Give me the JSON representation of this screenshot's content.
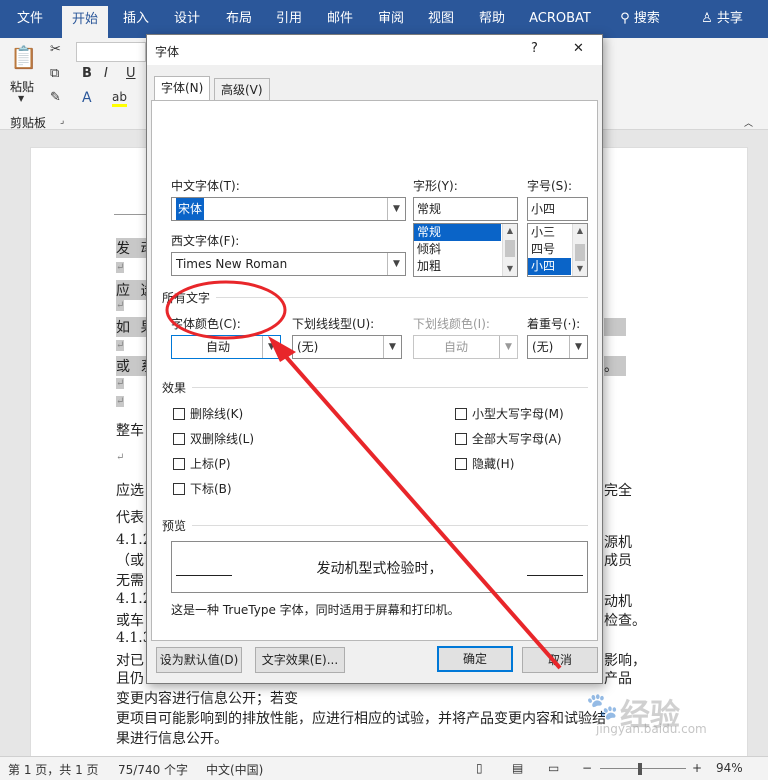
{
  "ribbon": {
    "tabs": [
      "文件",
      "开始",
      "插入",
      "设计",
      "布局",
      "引用",
      "邮件",
      "审阅",
      "视图",
      "帮助",
      "ACROBAT"
    ],
    "search": "搜索",
    "share": "共享",
    "paste_label": "粘贴",
    "clipboard_group": "剪贴板",
    "bold": "B",
    "italic": "I",
    "underline": "U"
  },
  "document": {
    "lines": [
      "发 动",
      "应 选",
      "如 果",
      "或 系",
      "整车",
      "应选",
      "代表",
      "4.1.2",
      "（或",
      "无需",
      "4.1.2",
      "或车",
      "4.1.3",
      "对已",
      "且仍",
      "变更内容进行信息公开；若变",
      "更项目可能影响到的排放性能，应进行相应的试验，并将产品变更内容和试验结",
      "果进行信息公开。"
    ],
    "right_fragments": [
      "完全",
      "源机",
      "成员",
      "动机",
      "检查。",
      "影响，",
      "产品",
      "。"
    ],
    "pilcrow": "↵"
  },
  "status": {
    "page": "第 1 页，共 1 页",
    "words": "75/740 个字",
    "lang": "中文(中国)",
    "zoom": "94%"
  },
  "dialog": {
    "title": "字体",
    "help": "?",
    "close": "✕",
    "tabs": [
      "字体(N)",
      "高级(V)"
    ],
    "cn_font_label": "中文字体(T):",
    "cn_font_value": "宋体",
    "west_font_label": "西文字体(F):",
    "west_font_value": "Times New Roman",
    "style_label": "字形(Y):",
    "style_value": "常规",
    "style_options": [
      "常规",
      "倾斜",
      "加粗"
    ],
    "size_label": "字号(S):",
    "size_value": "小四",
    "size_options": [
      "小三",
      "四号",
      "小四"
    ],
    "all_text_section": "所有文字",
    "color_label": "字体颜色(C):",
    "color_value": "自动",
    "underline_label": "下划线线型(U):",
    "underline_value": "(无)",
    "underline_color_label": "下划线颜色(I):",
    "underline_color_value": "自动",
    "emphasis_label": "着重号(·):",
    "emphasis_value": "(无)",
    "effects_section": "效果",
    "effects_left": [
      "删除线(K)",
      "双删除线(L)",
      "上标(P)",
      "下标(B)"
    ],
    "effects_right": [
      "小型大写字母(M)",
      "全部大写字母(A)",
      "隐藏(H)"
    ],
    "preview_section": "预览",
    "preview_text": "发动机型式检验时，",
    "preview_note": "这是一种 TrueType 字体，同时适用于屏幕和打印机。",
    "set_default": "设为默认值(D)",
    "text_effects": "文字效果(E)...",
    "ok": "确定",
    "cancel": "取消"
  },
  "watermark": {
    "text": "经验",
    "sub": "jingyan.baidu.com"
  },
  "colors": {
    "ribbon_blue": "#2b579a",
    "annotation_red": "#e8262a",
    "selection_blue": "#0a64c8"
  }
}
